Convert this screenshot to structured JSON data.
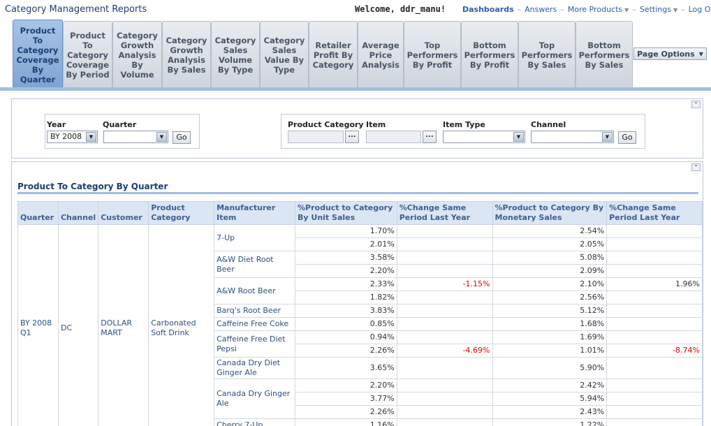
{
  "header": {
    "title": "Category Management Reports",
    "welcome": "Welcome, ddr_manu!",
    "nav": {
      "dashboards": "Dashboards",
      "answers": "Answers",
      "more_products": "More Products",
      "settings": "Settings",
      "logout": "Log Out"
    }
  },
  "tabs": [
    {
      "label": "Product To Category Coverage By Quarter",
      "active": true
    },
    {
      "label": "Product To Category Coverage By Period"
    },
    {
      "label": "Category Growth Analysis By Volume"
    },
    {
      "label": "Category Growth Analysis By Sales"
    },
    {
      "label": "Category Sales Volume By Type"
    },
    {
      "label": "Category Sales Value By Type"
    },
    {
      "label": "Retailer Profit By Category"
    },
    {
      "label": "Average Price Analysis"
    },
    {
      "label": "Top Performers By Profit"
    },
    {
      "label": "Bottom Performers By Profit"
    },
    {
      "label": "Top Performers By Sales"
    },
    {
      "label": "Bottom Performers By Sales"
    }
  ],
  "page_options_label": "Page Options",
  "prompts": {
    "year_label": "Year",
    "year_value": "BY 2008",
    "quarter_label": "Quarter",
    "quarter_value": "",
    "go_label": "Go",
    "product_category_label": "Product Category",
    "item_label": "Item",
    "item_type_label": "Item Type",
    "channel_label": "Channel",
    "browse_label": "..."
  },
  "report": {
    "title": "Product To Category By Quarter",
    "columns": [
      "Quarter",
      "Channel",
      "Customer",
      "Product Category",
      "Manufacturer Item",
      "%Product to Category By Unit Sales",
      "%Change Same Period Last Year",
      "%Product to Category By Monetary Sales",
      "%Change Same Period Last Year"
    ],
    "quarter": "BY 2008 Q1",
    "channel": "DC",
    "customer": "DOLLAR MART",
    "category": "Carbonated Soft Drink",
    "rows": [
      {
        "item": "7-Up",
        "span": 2,
        "unit": "1.70%",
        "chg1": "",
        "money": "2.54%",
        "chg2": ""
      },
      {
        "unit": "2.01%",
        "chg1": "",
        "money": "2.05%",
        "chg2": ""
      },
      {
        "item": "A&W Diet Root Beer",
        "span": 2,
        "unit": "3.58%",
        "chg1": "",
        "money": "5.08%",
        "chg2": ""
      },
      {
        "unit": "2.20%",
        "chg1": "",
        "money": "2.09%",
        "chg2": ""
      },
      {
        "item": "A&W Root Beer",
        "span": 2,
        "unit": "2.33%",
        "chg1": "-1.15%",
        "money": "2.10%",
        "chg2": "1.96%"
      },
      {
        "unit": "1.82%",
        "chg1": "",
        "money": "2.56%",
        "chg2": ""
      },
      {
        "item": "Barq's Root Beer",
        "span": 1,
        "unit": "3.83%",
        "chg1": "",
        "money": "5.12%",
        "chg2": ""
      },
      {
        "item": "Caffeine Free Coke",
        "span": 1,
        "unit": "0.85%",
        "chg1": "",
        "money": "1.68%",
        "chg2": ""
      },
      {
        "item": "Caffeine Free Diet Pepsi",
        "span": 2,
        "unit": "0.94%",
        "chg1": "",
        "money": "1.69%",
        "chg2": ""
      },
      {
        "unit": "2.26%",
        "chg1": "-4.69%",
        "money": "1.01%",
        "chg2": "-8.74%"
      },
      {
        "item": "Canada Dry Diet Ginger Ale",
        "span": 1,
        "unit": "3.65%",
        "chg1": "",
        "money": "5.90%",
        "chg2": ""
      },
      {
        "item": "Canada Dry Ginger Ale",
        "span": 3,
        "unit": "2.20%",
        "chg1": "",
        "money": "2.42%",
        "chg2": ""
      },
      {
        "unit": "3.77%",
        "chg1": "",
        "money": "5.94%",
        "chg2": ""
      },
      {
        "unit": "2.26%",
        "chg1": "",
        "money": "2.43%",
        "chg2": ""
      },
      {
        "item": "Cherry 7-Up",
        "span": 1,
        "unit": "1.16%",
        "chg1": "",
        "money": "1.22%",
        "chg2": ""
      }
    ]
  },
  "colors": {
    "active_tab": "#7ea3d1",
    "negative": "#e60000",
    "header_bg": "#dbe6f4"
  }
}
